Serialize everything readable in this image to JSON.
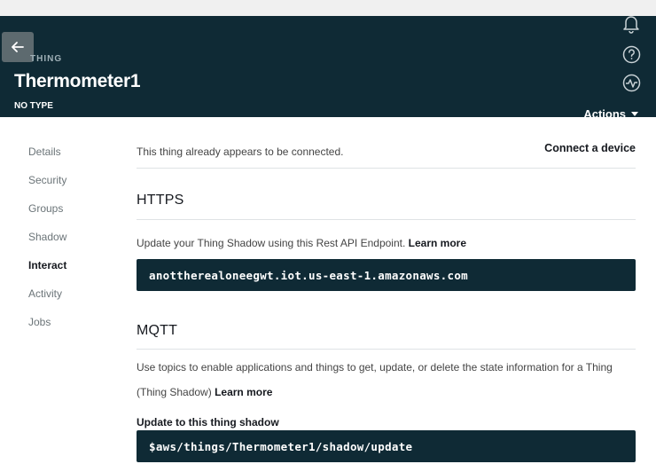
{
  "header": {
    "back_label": "←",
    "eyebrow": "THING",
    "title": "Thermometer1",
    "subtitle": "NO TYPE",
    "actions_label": "Actions",
    "icons": [
      "bell-icon",
      "help-icon",
      "activity-icon"
    ]
  },
  "sidebar": {
    "items": [
      {
        "label": "Details",
        "active": false
      },
      {
        "label": "Security",
        "active": false
      },
      {
        "label": "Groups",
        "active": false
      },
      {
        "label": "Shadow",
        "active": false
      },
      {
        "label": "Interact",
        "active": true
      },
      {
        "label": "Activity",
        "active": false
      },
      {
        "label": "Jobs",
        "active": false
      }
    ]
  },
  "main": {
    "connected_text": "This thing already appears to be connected.",
    "connect_link": "Connect a device",
    "https": {
      "title": "HTTPS",
      "description": "Update your Thing Shadow using this Rest API Endpoint.",
      "learn_more": "Learn more",
      "endpoint": "anottherealoneegwt.iot.us-east-1.amazonaws.com"
    },
    "mqtt": {
      "title": "MQTT",
      "description": "Use topics to enable applications and things to get, update, or delete the state information for a Thing (Thing Shadow)",
      "learn_more": "Learn more",
      "update_label": "Update to this thing shadow",
      "update_topic": "$aws/things/Thermometer1/shadow/update"
    }
  },
  "colors": {
    "header_bg": "#0f2a35",
    "code_bg": "#0f2a35",
    "back_button_bg": "#5d6a6f"
  }
}
